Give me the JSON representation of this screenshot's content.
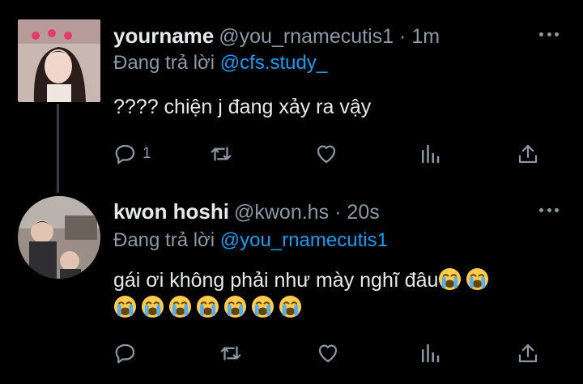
{
  "tweets": [
    {
      "name": "yourname",
      "handle": "@you_rnamecutis1",
      "separator": "·",
      "time": "1m",
      "replying_label": "Đang trả lời",
      "replying_to": "@cfs.study_",
      "text_lines": [
        "???? chiện j đang xảy ra vậy"
      ],
      "reply_count": "1"
    },
    {
      "name": "kwon hoshi",
      "handle": "@kwon.hs",
      "separator": "·",
      "time": "20s",
      "replying_label": "Đang trả lời",
      "replying_to": "@you_rnamecutis1",
      "text_lines": [
        "gái ơi không phải như mày nghĩ đâu"
      ],
      "reply_count": ""
    }
  ],
  "emoji_name": "loudly-crying-face",
  "colors": {
    "background": "#000000",
    "text": "#e7e9ea",
    "muted": "#8b98a5",
    "link": "#1d9bf0",
    "thread_line": "#3b3f45"
  },
  "icons": [
    "more-icon",
    "reply-icon",
    "retweet-icon",
    "like-icon",
    "analytics-icon",
    "share-icon"
  ]
}
